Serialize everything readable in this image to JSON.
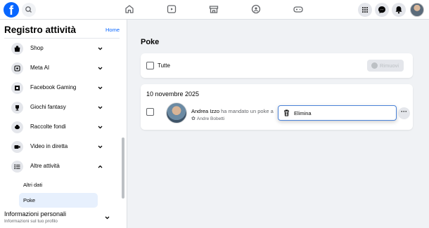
{
  "topbar": {
    "logo_letter": "f",
    "nav_icons": [
      "home-icon",
      "video-icon",
      "marketplace-icon",
      "groups-icon",
      "gaming-icon"
    ],
    "right_icons": [
      "menu-grid-icon",
      "messenger-icon",
      "notifications-icon"
    ],
    "brand_color": "#0866ff"
  },
  "sidebar": {
    "title": "Registro attività",
    "home_link": "Home",
    "items": [
      {
        "label": "Shop",
        "icon": "shop-icon"
      },
      {
        "label": "Meta AI",
        "icon": "meta-ai-icon"
      },
      {
        "label": "Facebook Gaming",
        "icon": "gaming-icon"
      },
      {
        "label": "Giochi fantasy",
        "icon": "trophy-icon"
      },
      {
        "label": "Raccolte fondi",
        "icon": "fundraiser-icon"
      },
      {
        "label": "Video in diretta",
        "icon": "live-video-icon"
      },
      {
        "label": "Altre attività",
        "icon": "list-icon"
      }
    ],
    "subitems": [
      {
        "label": "Altri dati"
      },
      {
        "label": "Poke"
      }
    ],
    "info_title": "Informazioni personali",
    "info_subtitle": "Informazioni sul tuo profilo"
  },
  "main": {
    "title": "Poke",
    "select_all_label": "Tutte",
    "remove_label": "Rimuovi",
    "date": "10 novembre 2025",
    "entry": {
      "name": "Andrea Izzo",
      "text": " ha mandato un poke a",
      "audience": "Andre Bobetti"
    },
    "delete_label": "Elimina",
    "more_label": "···"
  }
}
